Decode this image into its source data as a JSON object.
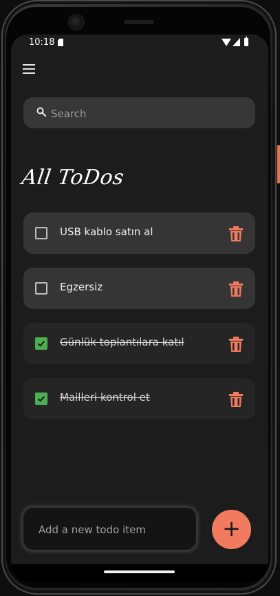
{
  "status_bar": {
    "time": "10:18"
  },
  "search": {
    "placeholder": "Search",
    "value": ""
  },
  "page_title": "All ToDos",
  "todos": [
    {
      "text": "USB kablo satın al",
      "done": false
    },
    {
      "text": "Egzersiz",
      "done": false
    },
    {
      "text": "Günlük toplantılara katıl",
      "done": true
    },
    {
      "text": "Mailleri kontrol et",
      "done": true
    }
  ],
  "new_todo": {
    "placeholder": "Add a new todo item",
    "value": ""
  },
  "add_button_label": "+",
  "colors": {
    "background": "#1d1c1c",
    "card": "#363535",
    "card_done": "#262525",
    "accent": "#f27a5e",
    "delete_icon": "#f27a5e",
    "checkbox_checked": "#4caf50"
  },
  "icons": {
    "menu": "hamburger-menu-icon",
    "search": "search-icon",
    "delete": "trash-icon",
    "checkbox": "checkbox-icon",
    "add": "plus-icon"
  }
}
